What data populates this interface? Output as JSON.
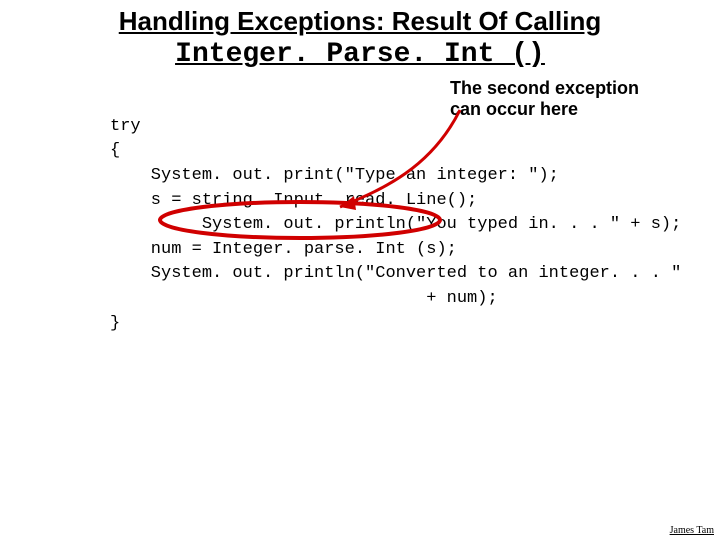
{
  "title": {
    "line1": "Handling Exceptions: Result Of Calling",
    "line2_mono": "Integer. Parse. Int ()"
  },
  "callout": "The second exception can occur here",
  "code": {
    "l1": "try",
    "l2": "{",
    "l3": "    System. out. print(\"Type an integer: \");",
    "l4": "    s = string. Input. read. Line();",
    "l5": "         System. out. println(\"You typed in. . . \" + s);",
    "l6": "    num = Integer. parse. Int (s);",
    "l7": "    System. out. println(\"Converted to an integer. . . \"",
    "l8": "                               + num);",
    "l9": "}"
  },
  "footer": "James Tam"
}
